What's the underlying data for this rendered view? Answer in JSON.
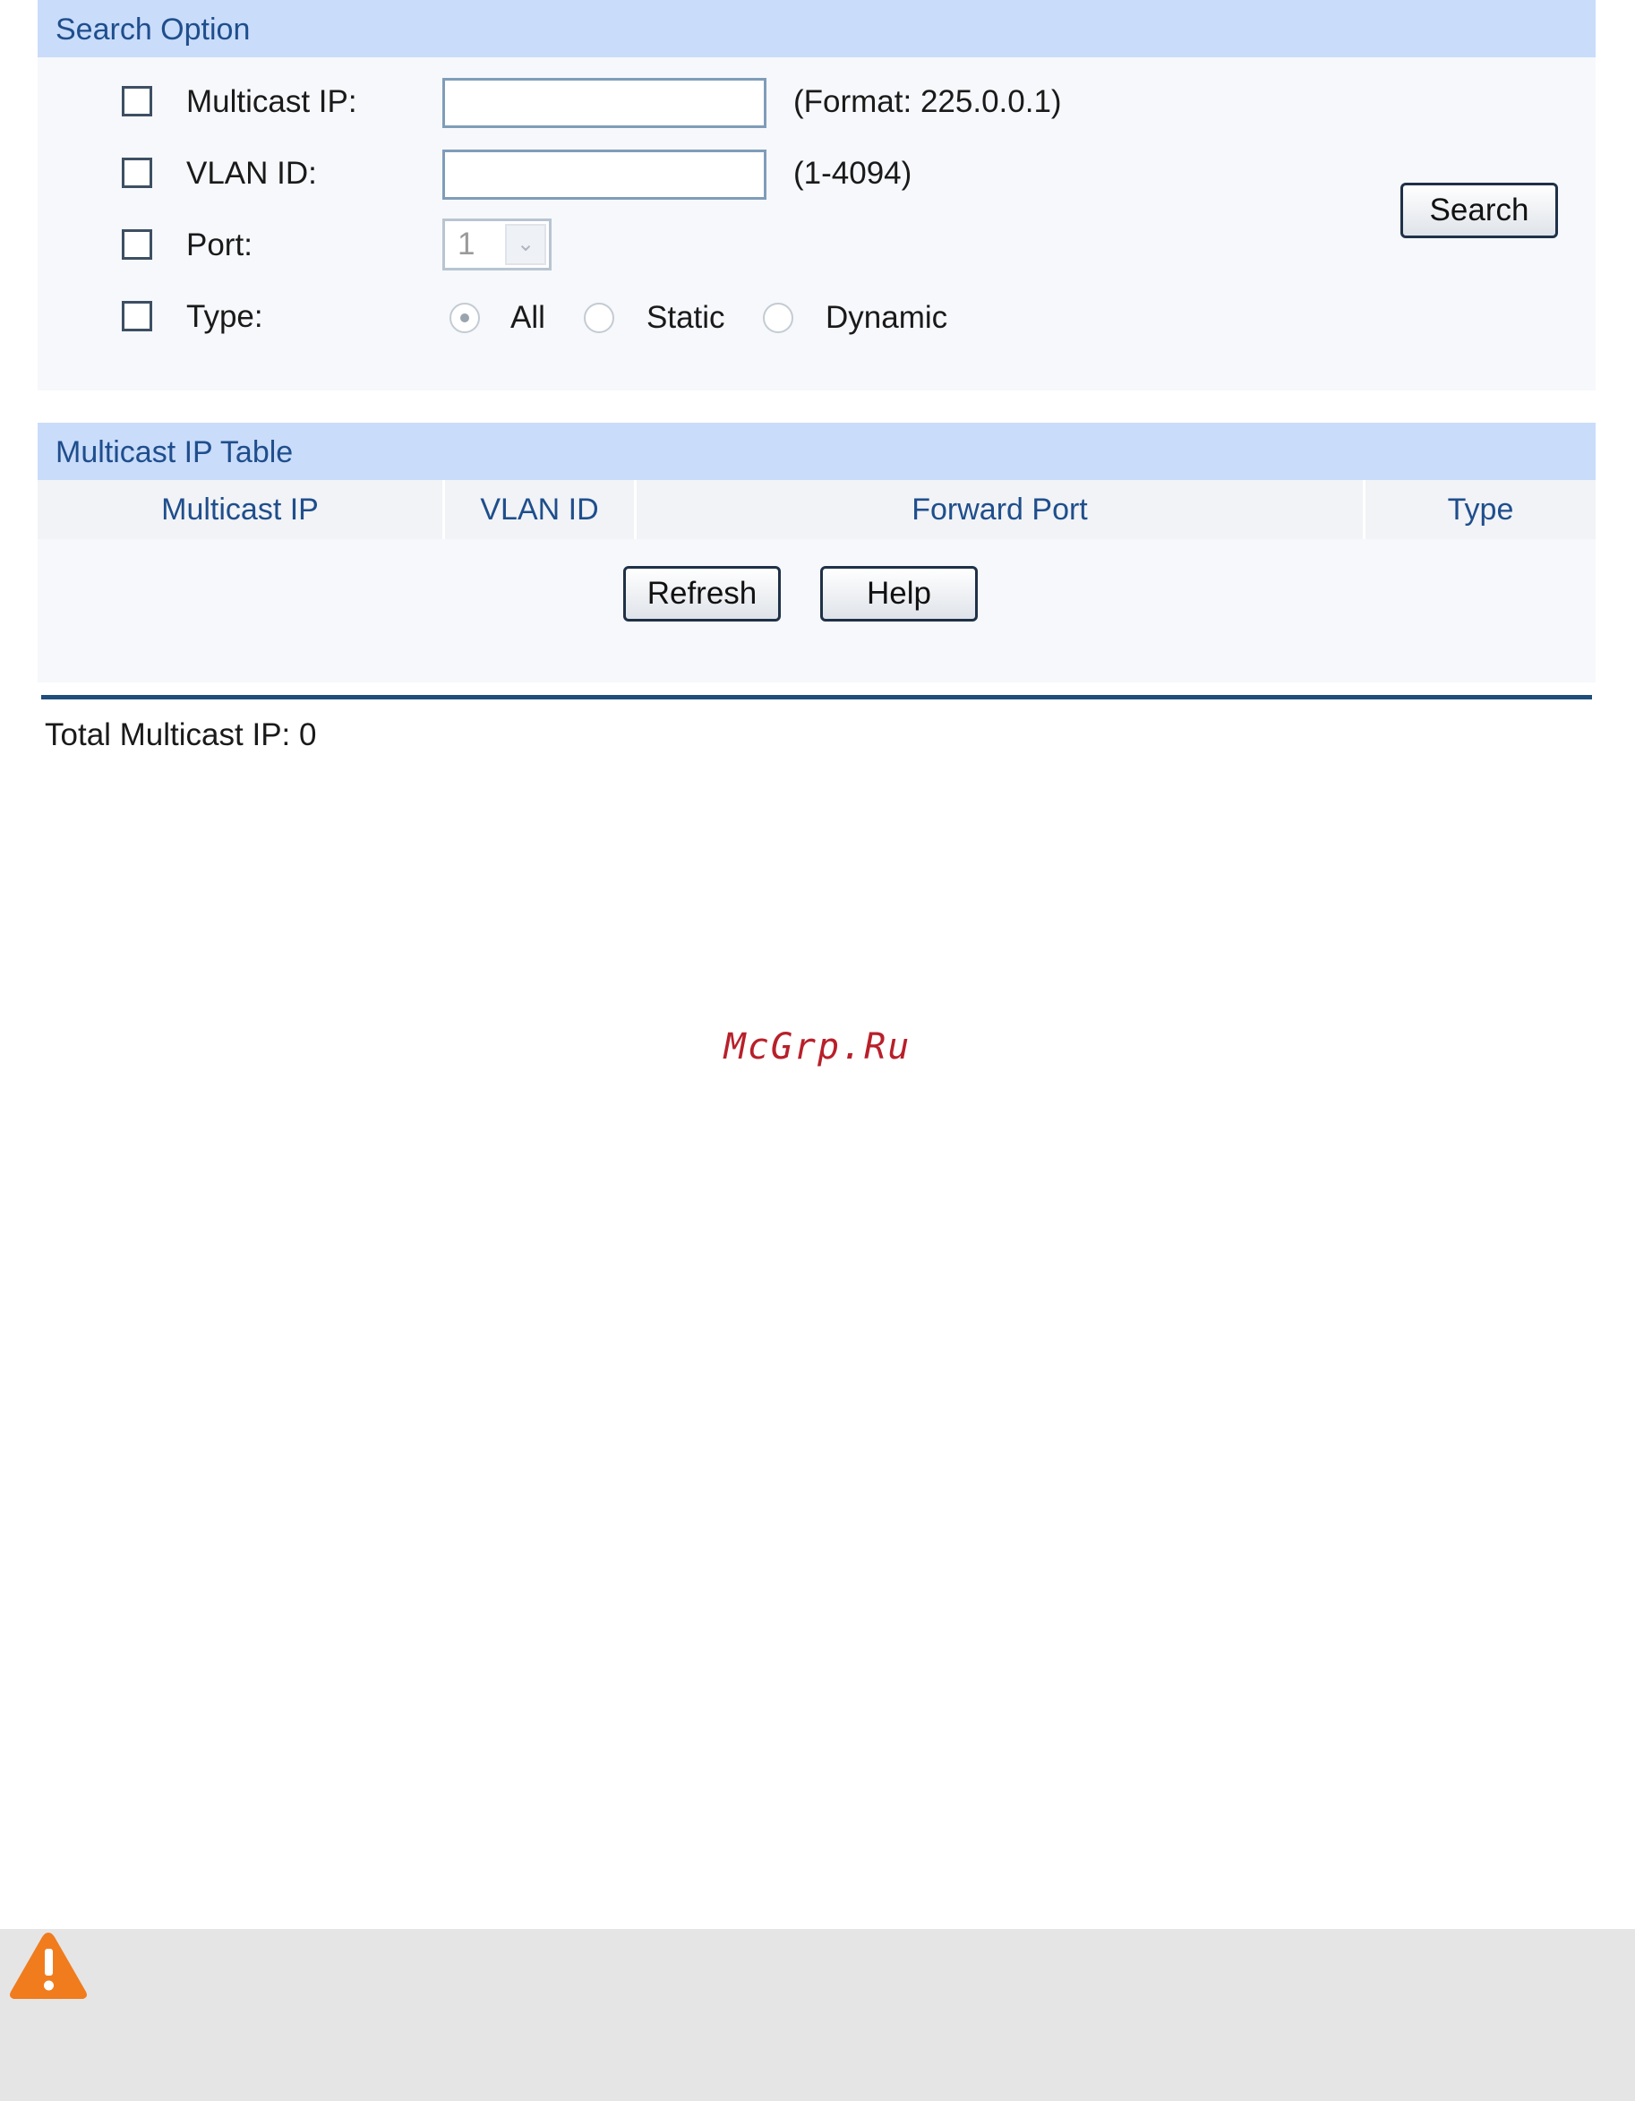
{
  "search_option": {
    "title": "Search Option",
    "multicast_ip": {
      "label": "Multicast IP:",
      "value": "",
      "hint": "(Format: 225.0.0.1)"
    },
    "vlan_id": {
      "label": "VLAN ID:",
      "value": "",
      "hint": "(1-4094)"
    },
    "port": {
      "label": "Port:",
      "selected": "1"
    },
    "type": {
      "label": "Type:",
      "options": [
        "All",
        "Static",
        "Dynamic"
      ],
      "selected": "All"
    },
    "search_button": "Search"
  },
  "multicast_table": {
    "title": "Multicast IP Table",
    "columns": [
      "Multicast IP",
      "VLAN ID",
      "Forward Port",
      "Type"
    ],
    "rows": [],
    "refresh_button": "Refresh",
    "help_button": "Help"
  },
  "summary": {
    "total_text": "Total Multicast IP: 0"
  },
  "watermark": "McGrp.Ru",
  "icons": {
    "warning": "warning-triangle-icon"
  },
  "colors": {
    "panel_header": "#c9dcfa",
    "header_text": "#1f4e8c",
    "warning": "#f07c1e"
  }
}
